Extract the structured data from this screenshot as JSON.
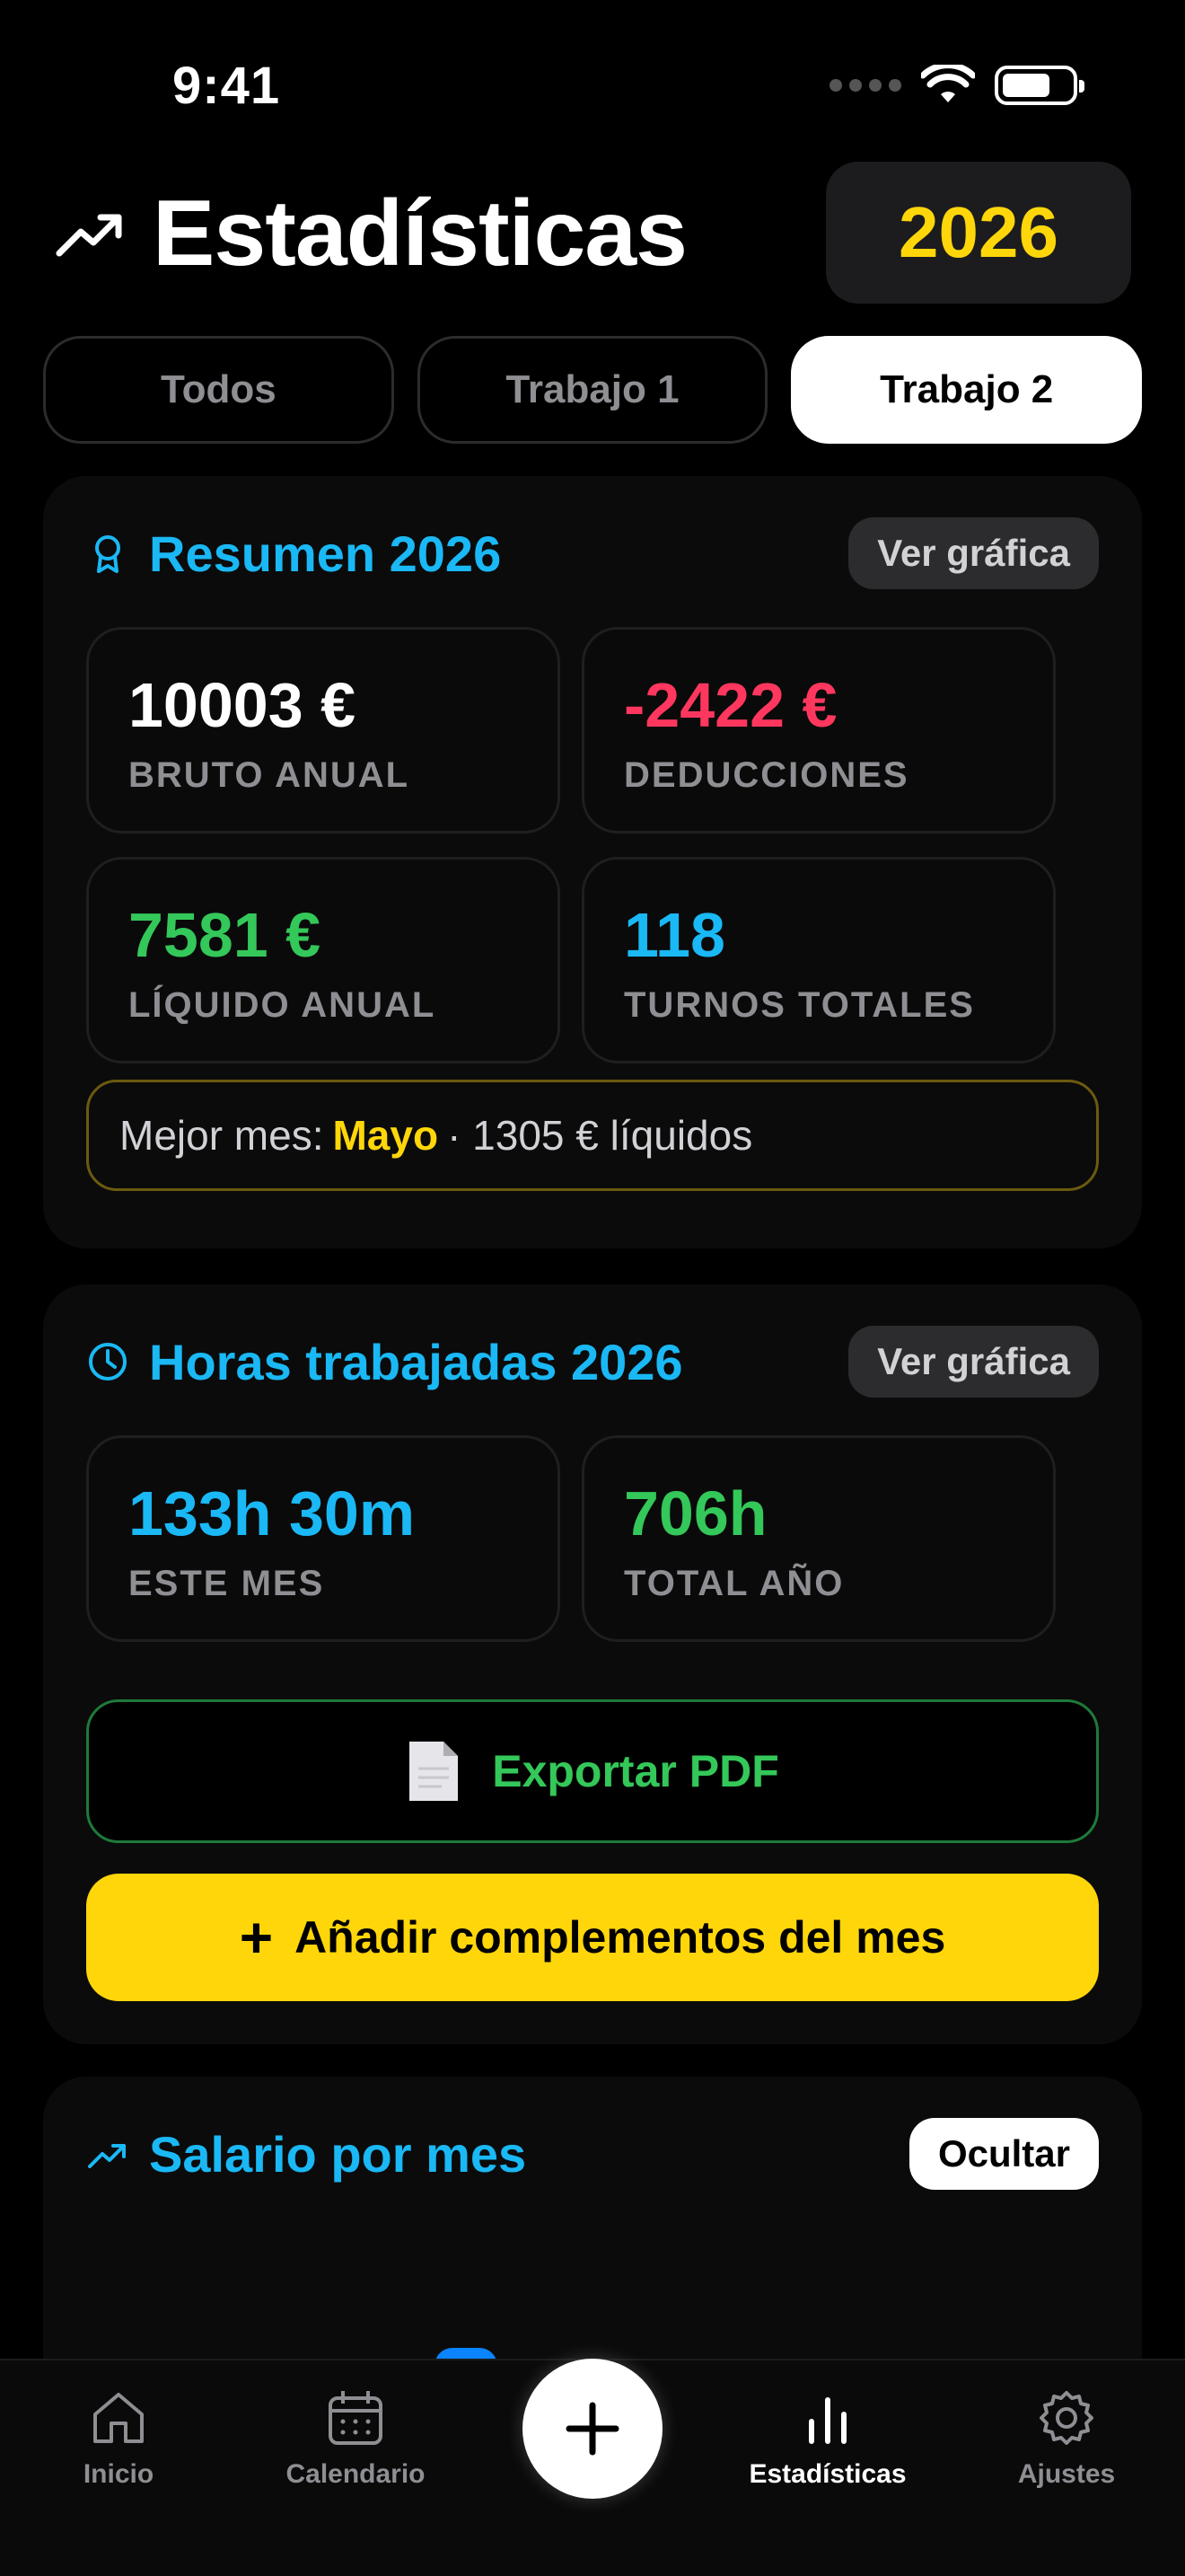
{
  "status_bar": {
    "time": "9:41"
  },
  "header": {
    "title": "Estadísticas",
    "year": "2026"
  },
  "tabs": [
    {
      "label": "Todos",
      "active": false
    },
    {
      "label": "Trabajo 1",
      "active": false
    },
    {
      "label": "Trabajo 2",
      "active": true
    }
  ],
  "summary": {
    "title": "Resumen 2026",
    "view_chart": "Ver gráfica",
    "stats": [
      {
        "value": "10003 €",
        "label": "BRUTO ANUAL",
        "color": "#ffffff"
      },
      {
        "value": "-2422 €",
        "label": "DEDUCCIONES",
        "color": "#ff375f"
      },
      {
        "value": "7581 €",
        "label": "LÍQUIDO ANUAL",
        "color": "#34c759"
      },
      {
        "value": "118",
        "label": "TURNOS TOTALES",
        "color": "#1ab8f5"
      }
    ],
    "best_month": {
      "prefix": "Mejor mes:",
      "month": "Mayo",
      "suffix": "· 1305 € líquidos"
    }
  },
  "hours": {
    "title": "Horas trabajadas 2026",
    "view_chart": "Ver gráfica",
    "stats": [
      {
        "value": "133h 30m",
        "label": "ESTE MES",
        "color": "#1ab8f5"
      },
      {
        "value": "706h",
        "label": "TOTAL AÑO",
        "color": "#34c759"
      }
    ],
    "export_label": "Exportar PDF",
    "add_label": "Añadir complementos del mes",
    "add_symbol": "+"
  },
  "salary": {
    "title": "Salario por mes",
    "hide_label": "Ocultar"
  },
  "tabbar": {
    "items": [
      {
        "label": "Inicio",
        "icon": "home-icon"
      },
      {
        "label": "Calendario",
        "icon": "calendar-icon"
      },
      {
        "label": "Estadísticas",
        "icon": "bar-chart-icon",
        "active": true
      },
      {
        "label": "Ajustes",
        "icon": "gear-icon"
      }
    ]
  },
  "colors": {
    "accent_blue": "#1ab8f5",
    "accent_yellow": "#ffd60a",
    "accent_green": "#34c759",
    "accent_red": "#ff375f"
  }
}
